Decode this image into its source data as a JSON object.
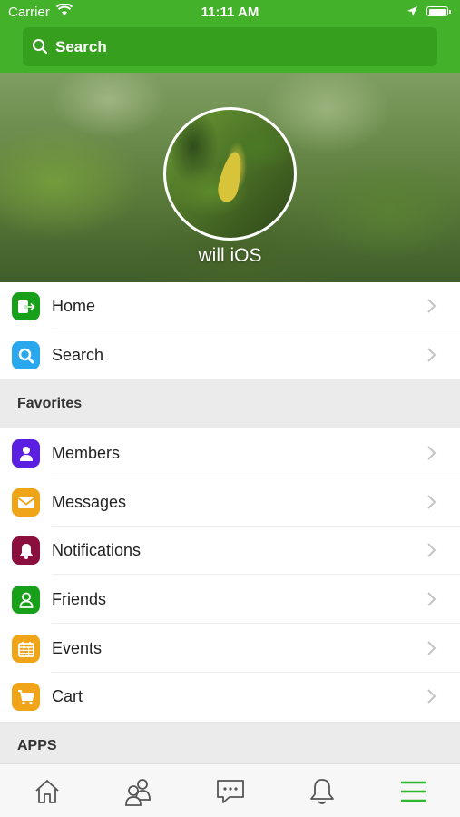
{
  "status_bar": {
    "carrier": "Carrier",
    "time": "11:11 AM"
  },
  "search": {
    "label": "Search"
  },
  "profile": {
    "name": "will iOS"
  },
  "menu": [
    {
      "label": "Home",
      "icon": "home-exit-icon",
      "color": "#19a01a"
    },
    {
      "label": "Search",
      "icon": "search-icon",
      "color": "#2aa8ee"
    }
  ],
  "sections": {
    "favorites": "Favorites",
    "apps": "APPS"
  },
  "favorites": [
    {
      "label": "Members",
      "icon": "member-icon",
      "color": "#5a1fe0"
    },
    {
      "label": "Messages",
      "icon": "envelope-icon",
      "color": "#f0a418"
    },
    {
      "label": "Notifications",
      "icon": "bell-icon",
      "color": "#8a0f3f"
    },
    {
      "label": "Friends",
      "icon": "friend-icon",
      "color": "#19a01a"
    },
    {
      "label": "Events",
      "icon": "calendar-icon",
      "color": "#f0a418"
    },
    {
      "label": "Cart",
      "icon": "cart-icon",
      "color": "#f0a418"
    }
  ],
  "tabbar": {
    "active_color": "#2eb82e",
    "items": [
      "home-tab-icon",
      "members-tab-icon",
      "messages-tab-icon",
      "notifications-tab-icon",
      "menu-tab-icon"
    ]
  }
}
